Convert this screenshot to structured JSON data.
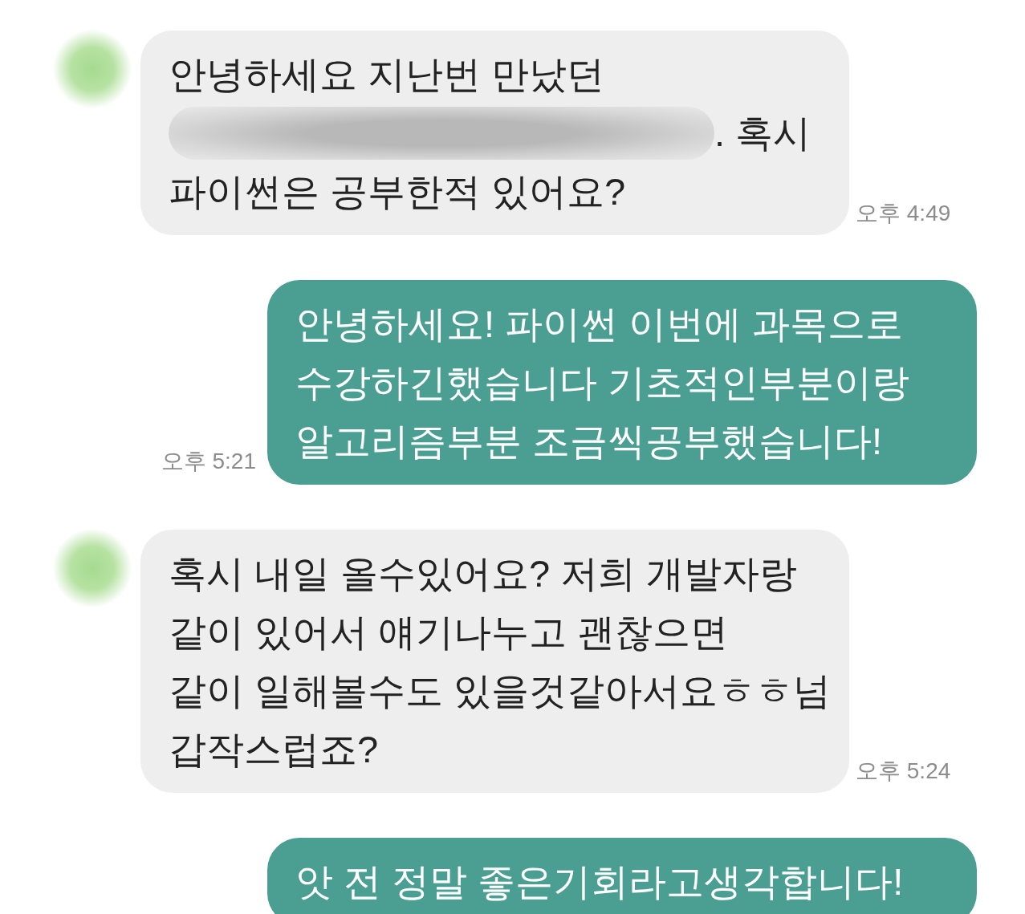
{
  "messages": [
    {
      "kind": "received",
      "lines": [
        {
          "text": "안녕하세요 지난번 만났던",
          "redacted": false
        },
        {
          "text": ". 혹시",
          "redacted": true
        },
        {
          "text": "파이썬은 공부한적 있어요?",
          "redacted": false
        }
      ],
      "time": "오후 4:49"
    },
    {
      "kind": "sent",
      "lines": [
        {
          "text": "안녕하세요! 파이썬 이번에 과목으로",
          "redacted": false
        },
        {
          "text": "수강하긴했습니다 기초적인부분이랑",
          "redacted": false
        },
        {
          "text": "알고리즘부분 조금씩공부했습니다!",
          "redacted": false
        }
      ],
      "time": "오후 5:21"
    },
    {
      "kind": "received",
      "lines": [
        {
          "text": "혹시 내일 올수있어요? 저희 개발자랑",
          "redacted": false
        },
        {
          "text": "같이 있어서 얘기나누고 괜찮으면",
          "redacted": false
        },
        {
          "text": "같이 일해볼수도 있을것같아서요ㅎㅎ넘",
          "redacted": false
        },
        {
          "text": "갑작스럽죠?",
          "redacted": false
        }
      ],
      "time": "오후 5:24"
    },
    {
      "kind": "sent",
      "lines": [
        {
          "text": "앗 전 정말 좋은기회라고생각합니다!",
          "redacted": false
        }
      ]
    }
  ]
}
